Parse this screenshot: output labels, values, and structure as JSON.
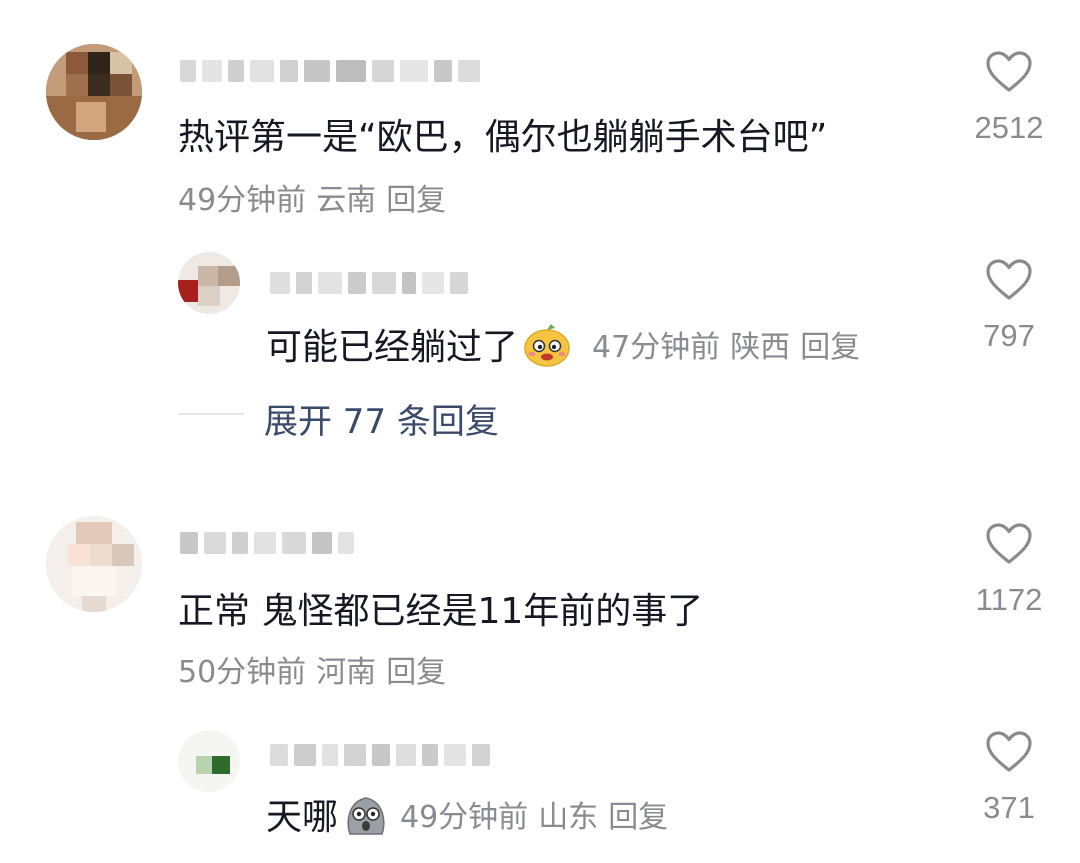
{
  "comments": [
    {
      "text": "热评第一是“欧巴，偶尔也躺躺手术台吧”",
      "time": "49分钟前",
      "location": "云南",
      "reply_label": "回复",
      "likes": "2512",
      "reply": {
        "text": "可能已经躺过了",
        "time": "47分钟前",
        "location": "陕西",
        "reply_label": "回复",
        "likes": "797",
        "emoji": "smirk-emoji"
      },
      "expand_label": "展开 77 条回复"
    },
    {
      "text": "正常 鬼怪都已经是11年前的事了",
      "time": "50分钟前",
      "location": "河南",
      "reply_label": "回复",
      "likes": "1172",
      "reply": {
        "text": "天哪",
        "time": "49分钟前",
        "location": "山东",
        "reply_label": "回复",
        "likes": "371",
        "emoji": "shocked-emoji"
      }
    }
  ],
  "colors": {
    "primary_text": "#161823",
    "secondary_text": "#8a8b91",
    "link_text": "#3a4a6b",
    "heart_outline": "#8a8b91"
  },
  "icons": [
    "heart-outline-icon",
    "smirk-emoji",
    "shocked-emoji"
  ]
}
